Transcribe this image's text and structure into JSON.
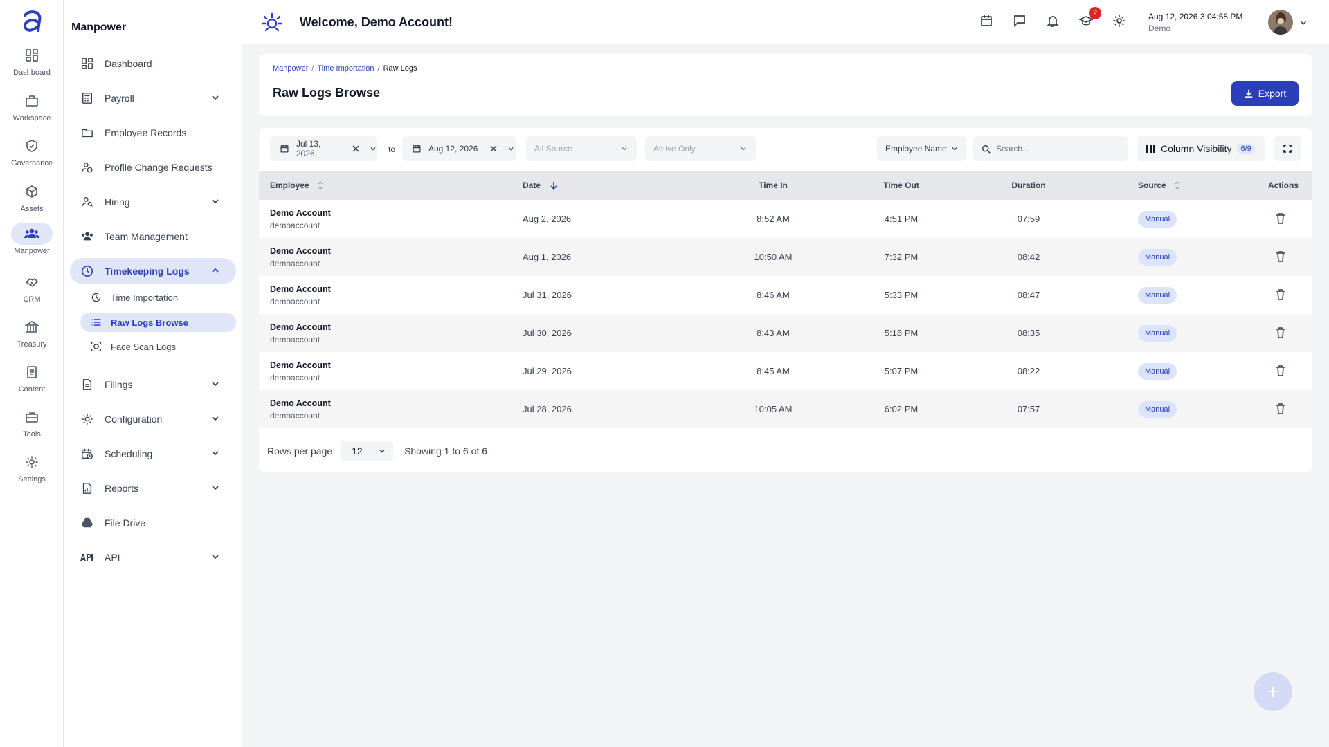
{
  "rail": {
    "items": [
      {
        "label": "Dashboard",
        "icon": "dashboard-icon"
      },
      {
        "label": "Workspace",
        "icon": "briefcase-icon"
      },
      {
        "label": "Governance",
        "icon": "shield-check-icon"
      },
      {
        "label": "Assets",
        "icon": "cube-icon"
      },
      {
        "label": "Manpower",
        "icon": "group-icon",
        "active": true
      },
      {
        "label": "CRM",
        "icon": "handshake-icon"
      },
      {
        "label": "Treasury",
        "icon": "bank-icon"
      },
      {
        "label": "Content",
        "icon": "document-icon"
      },
      {
        "label": "Tools",
        "icon": "toolbox-icon"
      },
      {
        "label": "Settings",
        "icon": "gear-icon"
      }
    ]
  },
  "sidebar": {
    "title": "Manpower",
    "items": [
      {
        "label": "Dashboard"
      },
      {
        "label": "Payroll"
      },
      {
        "label": "Employee Records"
      },
      {
        "label": "Profile Change Requests"
      },
      {
        "label": "Hiring"
      },
      {
        "label": "Team Management"
      },
      {
        "label": "Timekeeping Logs"
      },
      {
        "label": "Filings"
      },
      {
        "label": "Configuration"
      },
      {
        "label": "Scheduling"
      },
      {
        "label": "Reports"
      },
      {
        "label": "File Drive"
      },
      {
        "label": "API"
      }
    ],
    "sub_items": [
      {
        "label": "Time Importation"
      },
      {
        "label": "Raw Logs Browse"
      },
      {
        "label": "Face Scan Logs"
      }
    ]
  },
  "topbar": {
    "welcome": "Welcome, Demo Account!",
    "notification_count": "2",
    "date": "Aug 12, 2026",
    "time": "3:04:58 PM",
    "user": "Demo"
  },
  "breadcrumb": {
    "items": [
      "Manpower",
      "Time Importation",
      "Raw Logs"
    ],
    "separator": "/"
  },
  "page": {
    "title": "Raw Logs Browse",
    "export_label": "Export"
  },
  "filters": {
    "from_date": "Jul 13, 2026",
    "to_label": "to",
    "to_date": "Aug 12, 2026",
    "source_placeholder": "All Source",
    "status_placeholder": "Active Only",
    "search_field": "Employee Name",
    "search_placeholder": "Search...",
    "column_visibility_label": "Column Visibility",
    "column_visibility_count": "6/9"
  },
  "table": {
    "columns": [
      "Employee",
      "Date",
      "Time In",
      "Time Out",
      "Duration",
      "Source",
      "Actions"
    ],
    "rows": [
      {
        "name": "Demo Account",
        "username": "demoaccount",
        "date": "Aug 2, 2026",
        "time_in": "8:52 AM",
        "time_out": "4:51 PM",
        "duration": "07:59",
        "source": "Manual"
      },
      {
        "name": "Demo Account",
        "username": "demoaccount",
        "date": "Aug 1, 2026",
        "time_in": "10:50 AM",
        "time_out": "7:32 PM",
        "duration": "08:42",
        "source": "Manual"
      },
      {
        "name": "Demo Account",
        "username": "demoaccount",
        "date": "Jul 31, 2026",
        "time_in": "8:46 AM",
        "time_out": "5:33 PM",
        "duration": "08:47",
        "source": "Manual"
      },
      {
        "name": "Demo Account",
        "username": "demoaccount",
        "date": "Jul 30, 2026",
        "time_in": "8:43 AM",
        "time_out": "5:18 PM",
        "duration": "08:35",
        "source": "Manual"
      },
      {
        "name": "Demo Account",
        "username": "demoaccount",
        "date": "Jul 29, 2026",
        "time_in": "8:45 AM",
        "time_out": "5:07 PM",
        "duration": "08:22",
        "source": "Manual"
      },
      {
        "name": "Demo Account",
        "username": "demoaccount",
        "date": "Jul 28, 2026",
        "time_in": "10:05 AM",
        "time_out": "6:02 PM",
        "duration": "07:57",
        "source": "Manual"
      }
    ]
  },
  "pagination": {
    "rows_per_page_label": "Rows per page:",
    "rows_per_page": "12",
    "showing": "Showing 1 to 6 of 6"
  },
  "colors": {
    "accent": "#2a3fb8",
    "accent_light": "#e1e5f8",
    "badge_bg": "#dbe4fa",
    "notification": "#dc2626"
  }
}
